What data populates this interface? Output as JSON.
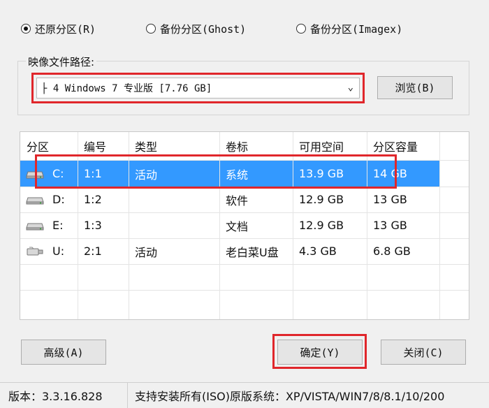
{
  "radios": [
    {
      "label": "还原分区(R)",
      "checked": true
    },
    {
      "label": "备份分区(Ghost)",
      "checked": false
    },
    {
      "label": "备份分区(Imagex)",
      "checked": false
    }
  ],
  "image_path": {
    "label": "映像文件路径:",
    "selected": "├ 4 Windows 7 专业版 [7.76 GB]",
    "browse_label": "浏览(B)"
  },
  "table": {
    "headers": [
      "分区",
      "编号",
      "类型",
      "卷标",
      "可用空间",
      "分区容量"
    ],
    "rows": [
      {
        "drive": "C:",
        "num": "1:1",
        "type": "活动",
        "label": "系统",
        "free": "13.9 GB",
        "size": "14 GB",
        "selected": true,
        "icon": "hard-drive-icon"
      },
      {
        "drive": "D:",
        "num": "1:2",
        "type": "",
        "label": "软件",
        "free": "12.9 GB",
        "size": "13 GB",
        "selected": false,
        "icon": "hard-drive-icon"
      },
      {
        "drive": "E:",
        "num": "1:3",
        "type": "",
        "label": "文档",
        "free": "12.9 GB",
        "size": "13 GB",
        "selected": false,
        "icon": "hard-drive-icon"
      },
      {
        "drive": "U:",
        "num": "2:1",
        "type": "活动",
        "label": "老白菜U盘",
        "free": "4.3 GB",
        "size": "6.8 GB",
        "selected": false,
        "icon": "usb-drive-icon"
      }
    ]
  },
  "buttons": {
    "advanced": "高级(A)",
    "ok": "确定(Y)",
    "close": "关闭(C)"
  },
  "status": {
    "version": "版本：3.3.16.828",
    "support": "支持安装所有(ISO)原版系统：XP/VISTA/WIN7/8/8.1/10/200"
  },
  "colors": {
    "highlight": "#e0262b",
    "selection": "#3399ff"
  }
}
